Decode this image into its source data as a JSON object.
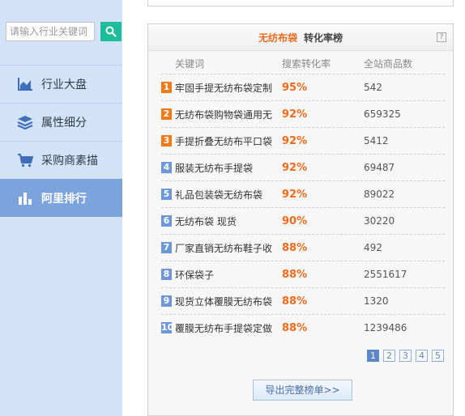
{
  "search": {
    "placeholder": "请输入行业关键词"
  },
  "nav": [
    {
      "label": "行业大盘",
      "icon": "area-chart-icon"
    },
    {
      "label": "属性细分",
      "icon": "layers-icon"
    },
    {
      "label": "采购商素描",
      "icon": "cart-icon"
    },
    {
      "label": "阿里排行",
      "icon": "bar-chart-icon",
      "active": true
    }
  ],
  "panel": {
    "keyword": "无纺布袋",
    "title": "转化率榜",
    "help": "?",
    "columns": [
      "关键词",
      "搜索转化率",
      "全站商品数"
    ],
    "rows": [
      {
        "rank": "1",
        "keyword": "牢固手提无纺布袋定制",
        "rate": "95%",
        "count": "542"
      },
      {
        "rank": "2",
        "keyword": "无纺布袋购物袋通用无",
        "rate": "92%",
        "count": "659325"
      },
      {
        "rank": "3",
        "keyword": "手提折叠无纺布平口袋",
        "rate": "92%",
        "count": "5412"
      },
      {
        "rank": "4",
        "keyword": "服装无纺布手提袋",
        "rate": "92%",
        "count": "69487"
      },
      {
        "rank": "5",
        "keyword": "礼品包装袋无纺布袋",
        "rate": "92%",
        "count": "89022"
      },
      {
        "rank": "6",
        "keyword": "无纺布袋 现货",
        "rate": "90%",
        "count": "30220"
      },
      {
        "rank": "7",
        "keyword": "厂家直销无纺布鞋子收",
        "rate": "88%",
        "count": "492"
      },
      {
        "rank": "8",
        "keyword": "环保袋子",
        "rate": "88%",
        "count": "2551617"
      },
      {
        "rank": "9",
        "keyword": "现货立体覆膜无纺布袋",
        "rate": "88%",
        "count": "1320"
      },
      {
        "rank": "10",
        "keyword": "覆膜无纺布手提袋定做",
        "rate": "88%",
        "count": "1239486"
      }
    ],
    "pages": [
      "1",
      "2",
      "3",
      "4",
      "5"
    ],
    "export_label": "导出完整榜单>>"
  },
  "colors": {
    "accent": "#f06b1c",
    "sidebar": "#d3e3f7",
    "active": "#7ba4dd",
    "search_button": "#1dbd9a"
  }
}
